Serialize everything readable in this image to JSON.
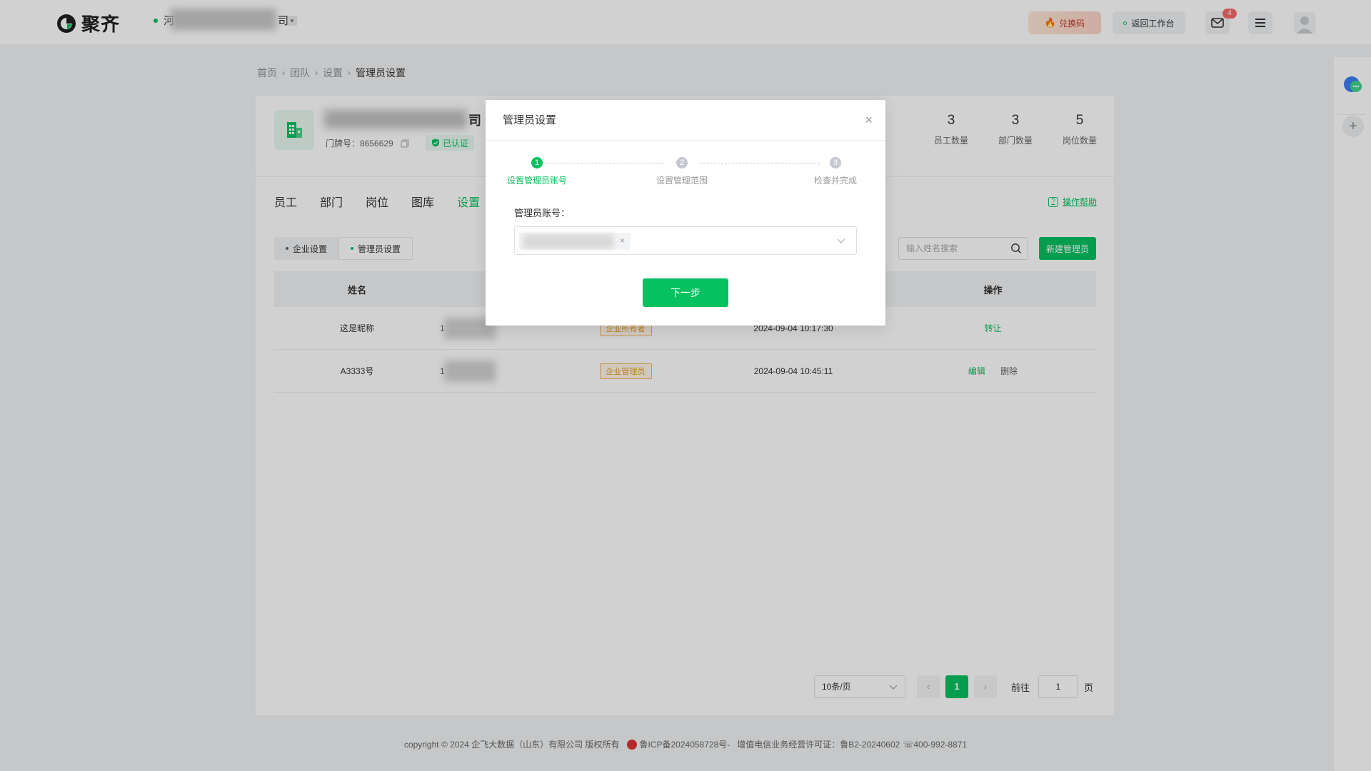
{
  "header": {
    "logo_text": "聚齐",
    "company_visible_left": "河",
    "company_visible_right": "司",
    "redeem_label": "兑换码",
    "back_label": "返回工作台",
    "mail_badge": "4"
  },
  "breadcrumb": [
    "首页",
    "团队",
    "设置",
    "管理员设置"
  ],
  "company": {
    "name_tail": "司",
    "door_no": "门牌号：8656629",
    "verified": "已认证",
    "stats": [
      {
        "value": "3",
        "label": "员工数量"
      },
      {
        "value": "3",
        "label": "部门数量"
      },
      {
        "value": "5",
        "label": "岗位数量"
      }
    ]
  },
  "tabs": [
    "员工",
    "部门",
    "岗位",
    "图库",
    "设置"
  ],
  "active_tab": "设置",
  "help_label": "操作帮助",
  "subtabs": [
    "企业设置",
    "管理员设置"
  ],
  "search_placeholder": "输入姓名搜索",
  "new_admin_label": "新建管理员",
  "table": {
    "headers": [
      "姓名",
      "",
      "",
      "",
      "操作"
    ],
    "rows": [
      {
        "name": "这是昵称",
        "phone_prefix": "1",
        "role": "企业所有者",
        "time": "2024-09-04 10:17:30",
        "ops": [
          "转让"
        ]
      },
      {
        "name": "A3333号",
        "phone_prefix": "1",
        "role": "企业管理员",
        "time": "2024-09-04 10:45:11",
        "ops": [
          "编辑",
          "删除"
        ]
      }
    ]
  },
  "pager": {
    "page_size": "10条/页",
    "current": "1",
    "goto_label": "前往",
    "goto_value": "1",
    "unit": "页"
  },
  "footer": {
    "copyright": "copyright © 2024 企飞大数据（山东）有限公司 版权所有",
    "icp": "鲁ICP备2024058728号-",
    "license": "增值电信业务经营许可证：鲁B2-20240602",
    "phone": "400-992-8871"
  },
  "modal": {
    "title": "管理员设置",
    "steps": [
      {
        "n": "1",
        "label": "设置管理员账号"
      },
      {
        "n": "2",
        "label": "设置管理范围"
      },
      {
        "n": "3",
        "label": "检查并完成"
      }
    ],
    "field_label": "管理员账号：",
    "next_label": "下一步"
  },
  "colors": {
    "accent": "#07c160",
    "role_tag": "#e79b2d",
    "badge": "#f56c6c"
  }
}
